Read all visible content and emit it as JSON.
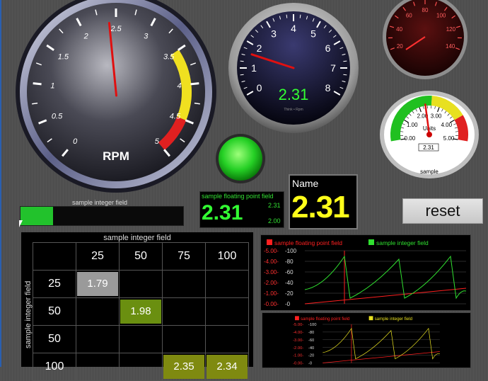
{
  "rpm_gauge": {
    "ticks": [
      "0",
      "0.5",
      "1",
      "1.5",
      "2",
      "2.5",
      "3",
      "3.5",
      "4",
      "4.5",
      "5"
    ],
    "title": "RPM",
    "value": 2.4
  },
  "small_dial": {
    "ticks": [
      "0",
      "1",
      "2",
      "3",
      "4",
      "5",
      "6",
      "7",
      "8"
    ],
    "readout": "2.31",
    "caption": "Think • Rpm"
  },
  "speedometer": {
    "ticks": [
      "20",
      "40",
      "60",
      "80",
      "100",
      "120",
      "140"
    ]
  },
  "units_meter": {
    "ticks": [
      "0.00",
      "1.00",
      "2.00",
      "3.00",
      "4.00",
      "5.00"
    ],
    "units_label": "Units",
    "readout": "2.31",
    "caption": "sample"
  },
  "status_bar": {
    "label": "sample integer field",
    "fill_fraction": 0.2
  },
  "digital_display": {
    "label": "sample floating point field",
    "value": "2.31",
    "scale_max": "2.31",
    "scale_min": "2.00"
  },
  "name_box": {
    "title": "Name",
    "value": "2.31"
  },
  "reset_button": {
    "label": "reset"
  },
  "table": {
    "top_label": "sample integer field",
    "side_label": "sample integer field",
    "columns": [
      "25",
      "50",
      "75",
      "100"
    ],
    "rows": [
      {
        "head": "25",
        "cells": [
          "1.79",
          "",
          "",
          ""
        ]
      },
      {
        "head": "50",
        "cells": [
          "",
          "1.98",
          "",
          ""
        ]
      },
      {
        "head": "50",
        "cells": [
          "",
          "",
          "",
          ""
        ]
      },
      {
        "head": "100",
        "cells": [
          "",
          "",
          "2.35",
          "2.34"
        ]
      }
    ],
    "cell_colors": {
      "1.79": "#9a9a9a",
      "1.98": "#6a8f10",
      "2.35": "#7f8a10",
      "2.34": "#7f8a10"
    }
  },
  "chart_data": [
    {
      "type": "line",
      "legend": [
        "sample floating point field",
        "sample integer field"
      ],
      "left_ticks": [
        "5.00",
        "4.00",
        "3.00",
        "2.00",
        "1.00",
        "0.00"
      ],
      "right_ticks": [
        "100",
        "80",
        "60",
        "40",
        "20",
        "0"
      ],
      "colors": [
        "#ff2020",
        "#30e030"
      ]
    },
    {
      "type": "line",
      "legend": [
        "sample floating point field",
        "sample integer field"
      ],
      "left_ticks": [
        "5.00",
        "4.00",
        "3.00",
        "2.00",
        "1.00",
        "0.00"
      ],
      "right_ticks": [
        "100",
        "80",
        "60",
        "40",
        "20",
        "0"
      ],
      "colors": [
        "#ff2020",
        "#e8e020"
      ]
    }
  ]
}
